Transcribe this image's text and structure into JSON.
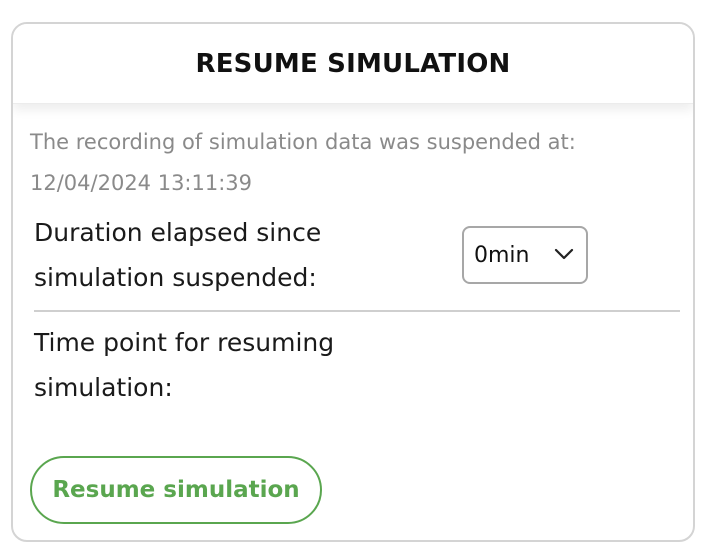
{
  "header": {
    "title": "RESUME SIMULATION"
  },
  "info": {
    "suspended_message": "The recording of simulation data was suspended at:",
    "suspended_timestamp": "12/04/2024 13:11:39"
  },
  "duration": {
    "label": "Duration elapsed since simulation suspended:",
    "selected_value": "0min"
  },
  "timepoint": {
    "label": "Time point for resuming simulation:"
  },
  "actions": {
    "resume_label": "Resume simulation"
  },
  "colors": {
    "accent_green": "#5aa64f",
    "muted_text": "#8a8a8a",
    "border": "#d4d4d4"
  },
  "icons": {
    "select_chevron": "chevron-down-icon"
  }
}
